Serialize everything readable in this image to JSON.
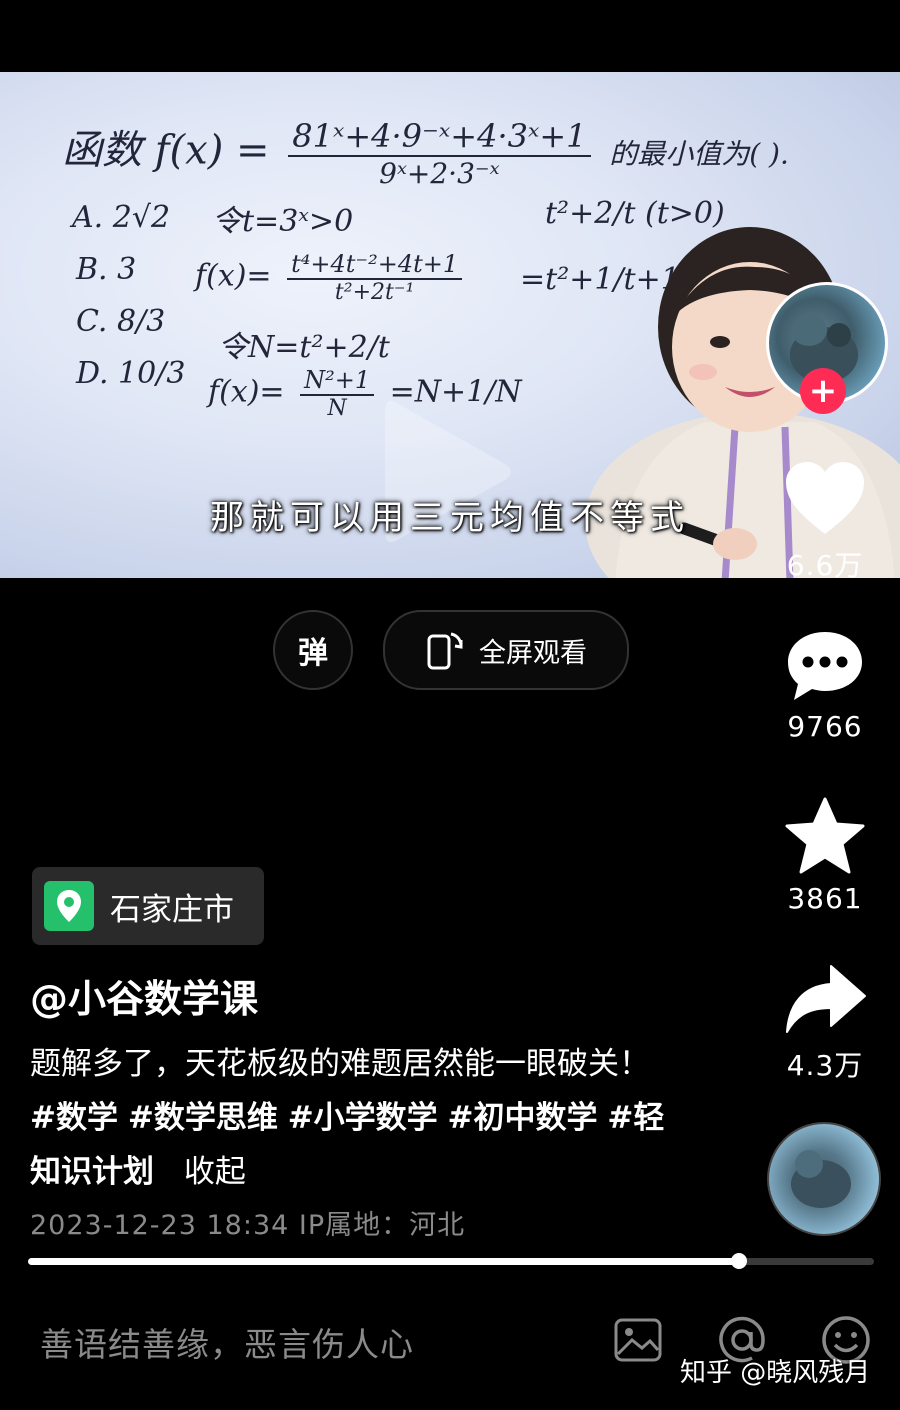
{
  "video": {
    "whiteboard": {
      "line1_prefix": "函数",
      "line1_fx": "f(x) =",
      "line1_num": "81ˣ+4·9⁻ˣ+4·3ˣ+1",
      "line1_den": "9ˣ+2·3⁻ˣ",
      "line1_suffix": "的最小值为(    ).",
      "optA": "A. 2√2",
      "optB": "B. 3",
      "optC": "C. 8/3",
      "optD": "D. 10/3",
      "step1": "令t=3ˣ>0",
      "step2_fx": "f(x)=",
      "step2_num": "t⁴+4t⁻²+4t+1",
      "step2_den": "t²+2t⁻¹",
      "step3": "令N=t²+2/t",
      "step4_fx": "f(x)=",
      "step4_num": "N²+1",
      "step4_den": "N",
      "step4_rest": "=N+1/N",
      "side1": "t²+2/t (t>0)",
      "side2": "=t²+1/t+1/t"
    },
    "subtitle": "那就可以用三元均值不等式"
  },
  "controls": {
    "danmu_label": "弹",
    "fullscreen_label": "全屏观看"
  },
  "actions": {
    "like_count": "6.6万",
    "comment_count": "9766",
    "favorite_count": "3861",
    "share_count": "4.3万"
  },
  "post": {
    "location": "石家庄市",
    "author": "@小谷数学课",
    "desc_text": "题解多了，天花板级的难题居然能一眼破关！",
    "tags": [
      "#数学",
      "#数学思维",
      "#小学数学",
      "#初中数学",
      "#轻知识计划"
    ],
    "collapse_label": "收起",
    "meta": "2023-12-23 18:34  IP属地：河北"
  },
  "progress": {
    "fraction": 0.84
  },
  "comment_bar": {
    "placeholder": "善语结善缘，恶言伤人心",
    "icons": [
      "image-icon",
      "mention-icon",
      "emoji-icon"
    ]
  },
  "watermark": "知乎 @晓风残月",
  "colors": {
    "follow": "#fe2c55",
    "location_icon": "#25c06b",
    "background": "#000000"
  }
}
